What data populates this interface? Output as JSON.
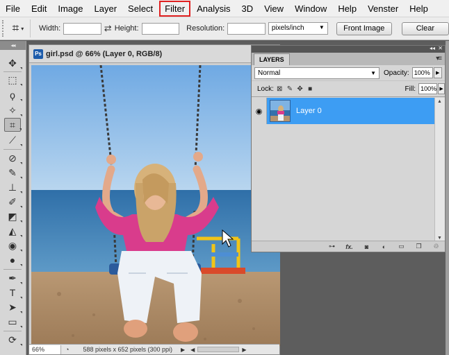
{
  "menubar": {
    "items": [
      "File",
      "Edit",
      "Image",
      "Layer",
      "Select",
      "Filter",
      "Analysis",
      "3D",
      "View",
      "Window",
      "Help",
      "Venster",
      "Help"
    ],
    "highlighted": "Filter",
    "highlight_color": "#e02020"
  },
  "options_bar": {
    "tool_icon": "crop-icon",
    "width_label": "Width:",
    "width_value": "",
    "height_label": "Height:",
    "height_value": "",
    "resolution_label": "Resolution:",
    "resolution_value": "",
    "units": "pixels/inch",
    "front_image_label": "Front Image",
    "clear_label": "Clear"
  },
  "tools": [
    {
      "name": "move-tool",
      "icon": "move-icon"
    },
    {
      "name": "marquee-tool",
      "icon": "marquee-icon"
    },
    {
      "name": "lasso-tool",
      "icon": "lasso-icon"
    },
    {
      "name": "quick-selection-tool",
      "icon": "magic-wand-icon"
    },
    {
      "name": "crop-tool",
      "icon": "crop-icon",
      "active": true
    },
    {
      "name": "eyedropper-tool",
      "icon": "eyedropper-icon"
    },
    {
      "name": "healing-brush-tool",
      "icon": "bandage-icon"
    },
    {
      "name": "brush-tool",
      "icon": "brush-icon"
    },
    {
      "name": "clone-stamp-tool",
      "icon": "stamp-icon"
    },
    {
      "name": "history-brush-tool",
      "icon": "history-brush-icon"
    },
    {
      "name": "eraser-tool",
      "icon": "eraser-icon"
    },
    {
      "name": "paint-bucket-tool",
      "icon": "bucket-icon"
    },
    {
      "name": "blur-tool",
      "icon": "drop-icon"
    },
    {
      "name": "dodge-tool",
      "icon": "dodge-icon"
    },
    {
      "name": "pen-tool",
      "icon": "pen-icon"
    },
    {
      "name": "type-tool",
      "icon": "type-icon"
    },
    {
      "name": "path-selection-tool",
      "icon": "arrow-icon"
    },
    {
      "name": "shape-tool",
      "icon": "rectangle-icon"
    },
    {
      "name": "3d-rotate-tool",
      "icon": "3d-icon"
    }
  ],
  "document": {
    "badge": "Ps",
    "title": "girl.psd @ 66% (Layer 0, RGB/8)",
    "zoom": "66%",
    "status": "588 pixels x 652 pixels (300 ppi)"
  },
  "layers_panel": {
    "tab": "LAYERS",
    "blend_mode": "Normal",
    "opacity_label": "Opacity:",
    "opacity_value": "100%",
    "lock_label": "Lock:",
    "fill_label": "Fill:",
    "fill_value": "100%",
    "layers": [
      {
        "name": "Layer 0",
        "visible": true,
        "selected": true
      }
    ],
    "bottom_icons": [
      "link-icon",
      "fx-icon",
      "mask-icon",
      "adjustment-icon",
      "group-folder-icon",
      "new-layer-icon",
      "trash-icon"
    ],
    "fx_label": "fx."
  },
  "colors": {
    "selection_blue": "#3d9df3",
    "ps_badge_blue": "#1d5cab",
    "workspace_grey": "#5d5d5d"
  }
}
